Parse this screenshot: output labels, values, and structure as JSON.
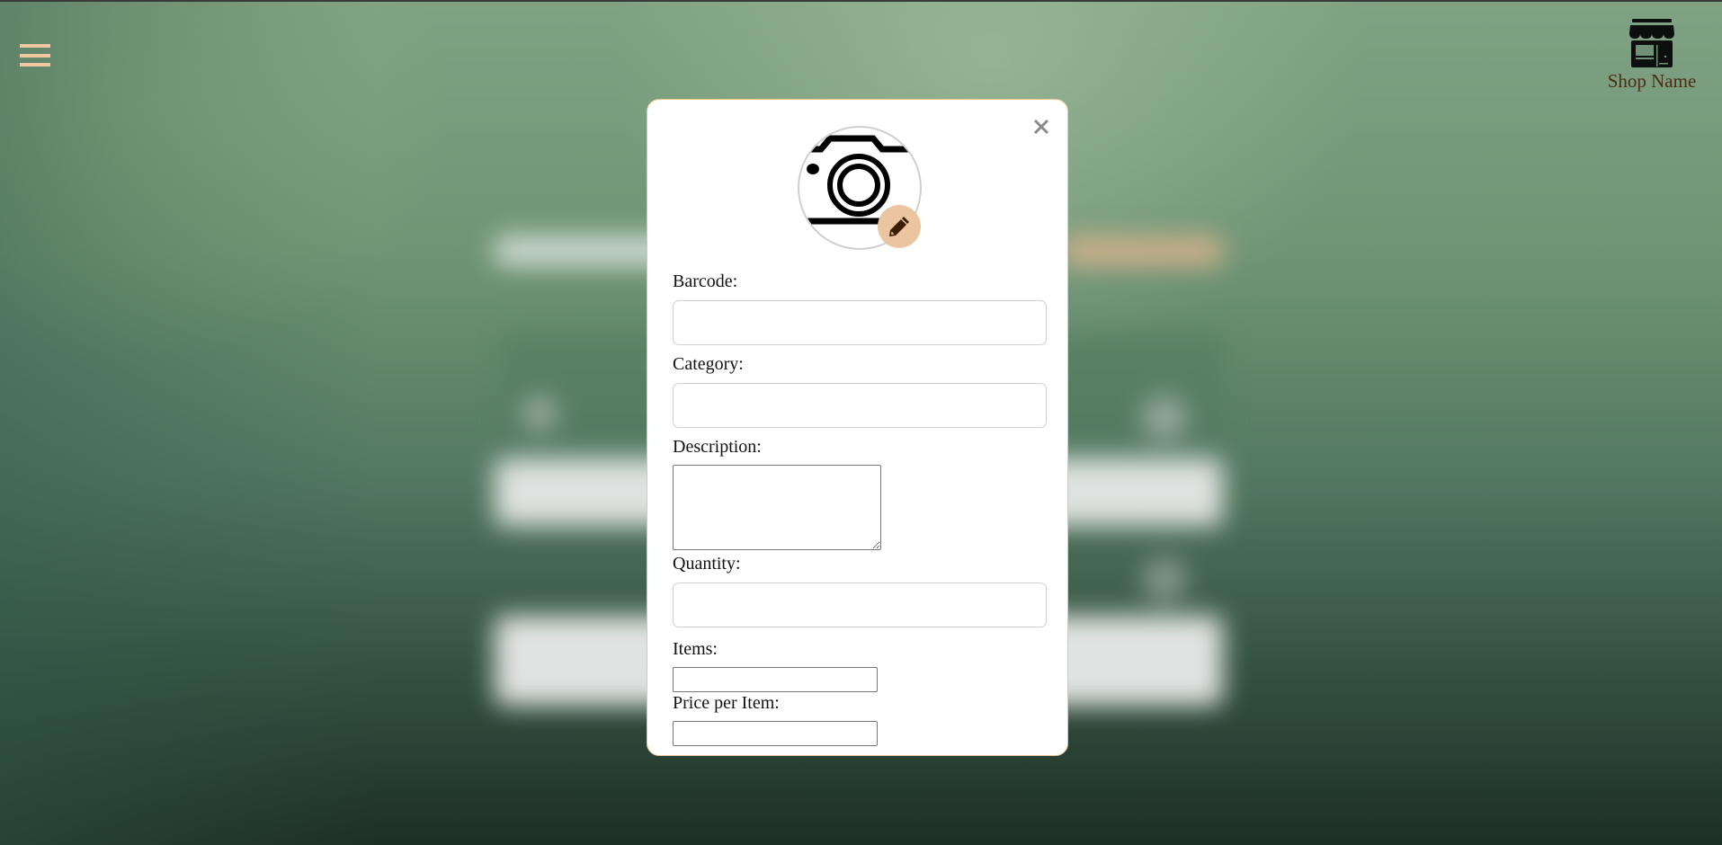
{
  "header": {
    "menu_icon": "hamburger-menu-icon",
    "shop_icon": "storefront-icon",
    "shop_name": "Shop Name"
  },
  "modal": {
    "close_icon": "close-x-icon",
    "image_placeholder_icon": "camera-icon",
    "edit_image_icon": "pencil-icon",
    "fields": {
      "barcode": {
        "label": "Barcode:",
        "value": "",
        "placeholder": ""
      },
      "category": {
        "label": "Category:",
        "value": "",
        "placeholder": ""
      },
      "description": {
        "label": "Description:",
        "value": "",
        "placeholder": ""
      },
      "quantity": {
        "label": "Quantity:",
        "value": "",
        "placeholder": ""
      },
      "items": {
        "label": "Items:",
        "value": "",
        "placeholder": ""
      },
      "price_per_item": {
        "label": "Price per Item:",
        "value": "",
        "placeholder": ""
      }
    }
  },
  "colors": {
    "accent": "#ebc59f",
    "shop_name_text": "#4b2d14",
    "modal_border": "#e8c39c",
    "close_icon": "#8a8a8a"
  }
}
